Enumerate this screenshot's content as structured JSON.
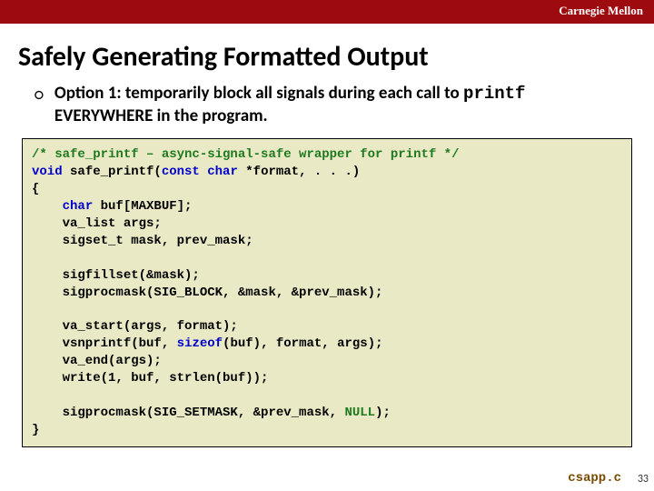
{
  "header": {
    "university": "Carnegie Mellon"
  },
  "title": "Safely Generating Formatted Output",
  "bullet": {
    "pre": "Option 1: temporarily block all signals during each call to ",
    "mono": "printf",
    "post": " EVERYWHERE in the program."
  },
  "code": {
    "l1_comment": "/* safe_printf – async-signal-safe wrapper for printf */",
    "l2_a": "void",
    "l2_b": " safe_printf(",
    "l2_c": "const",
    "l2_d": " ",
    "l2_e": "char",
    "l2_f": " *format, . . .)",
    "l3": "{",
    "l4_a": "    ",
    "l4_b": "char",
    "l4_c": " buf[MAXBUF];",
    "l5": "    va_list args;",
    "l6": "    sigset_t mask, prev_mask;",
    "l7": "",
    "l8": "    sigfillset(&mask);",
    "l9": "    sigprocmask(SIG_BLOCK, &mask, &prev_mask);",
    "l10": "",
    "l11": "    va_start(args, format);",
    "l12_a": "    vsnprintf(buf, ",
    "l12_b": "sizeof",
    "l12_c": "(buf), format, args);",
    "l13": "    va_end(args);",
    "l14": "    write(1, buf, strlen(buf));",
    "l15": "",
    "l16_a": "    sigprocmask(SIG_SETMASK, &prev_mask, ",
    "l16_b": "NULL",
    "l16_c": ");",
    "l17": "}"
  },
  "filename": "csapp.c",
  "page": "33"
}
